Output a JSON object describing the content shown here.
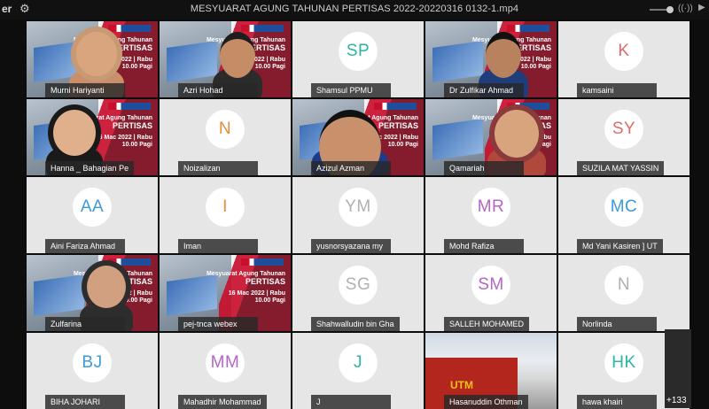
{
  "window": {
    "app_fragment": "er",
    "title": "MESYUARAT AGUNG TAHUNAN PERTISAS 2022-20220316 0132-1.mp4"
  },
  "slide": {
    "line1": "Mesyuarat Agung Tahunan",
    "line2": "PERTISAS",
    "line3": "16 Mac 2022 | Rabu",
    "line4": "10.00 Pagi"
  },
  "utm_logo": "UTM",
  "participants": [
    {
      "name": "Murni Hariyanti",
      "type": "video"
    },
    {
      "name": "Azri Hohad",
      "type": "video"
    },
    {
      "name": "Shamsul PPMU",
      "initials": "SP",
      "color": "#2bb5a3"
    },
    {
      "name": "Dr Zulfikar Ahmad",
      "type": "video"
    },
    {
      "name": "kamsaini",
      "initials": "K",
      "color": "#e06b6b"
    },
    {
      "name": "Hanna _ Bahagian Pe",
      "type": "video"
    },
    {
      "name": "Noizalizan",
      "initials": "N",
      "color": "#e88c3a"
    },
    {
      "name": "Azizul Azman",
      "type": "video"
    },
    {
      "name": "Qamariah",
      "type": "video"
    },
    {
      "name": "SUZILA MAT YASSIN",
      "initials": "SY",
      "color": "#e06b6b"
    },
    {
      "name": "Aini Fariza Ahmad",
      "initials": "AA",
      "color": "#3b9ad9"
    },
    {
      "name": "Iman",
      "initials": "I",
      "color": "#e88c3a"
    },
    {
      "name": "yusnorsyazana my",
      "initials": "YM",
      "color": "#b0b0b0"
    },
    {
      "name": "Mohd Rafiza",
      "initials": "MR",
      "color": "#b565c9"
    },
    {
      "name": "Md Yani Kasiren ] UT",
      "initials": "MC",
      "color": "#3b9ad9"
    },
    {
      "name": "Zulfarina",
      "type": "video"
    },
    {
      "name": "pej-tnca webex",
      "type": "video"
    },
    {
      "name": "Shahwalludin bin Gha",
      "initials": "SG",
      "color": "#b0b0b0"
    },
    {
      "name": "SALLEH MOHAMED",
      "initials": "SM",
      "color": "#b565c9"
    },
    {
      "name": "Norlinda",
      "initials": "N",
      "color": "#b0b0b0"
    },
    {
      "name": "BIHA JOHARI",
      "initials": "BJ",
      "color": "#3b9ad9"
    },
    {
      "name": "Mahadhir Mohammad",
      "initials": "MM",
      "color": "#b565c9"
    },
    {
      "name": "J",
      "initials": "J",
      "color": "#2bb5a3"
    },
    {
      "name": "Hasanuddin Othman",
      "type": "video"
    },
    {
      "name": "hawa khairi",
      "initials": "HK",
      "color": "#2bb5a3"
    }
  ],
  "more_count": "+133",
  "colors": {
    "tile_bg": "#e6e6e6",
    "nameplate": "#282828",
    "accent_red": "#c8102e"
  }
}
